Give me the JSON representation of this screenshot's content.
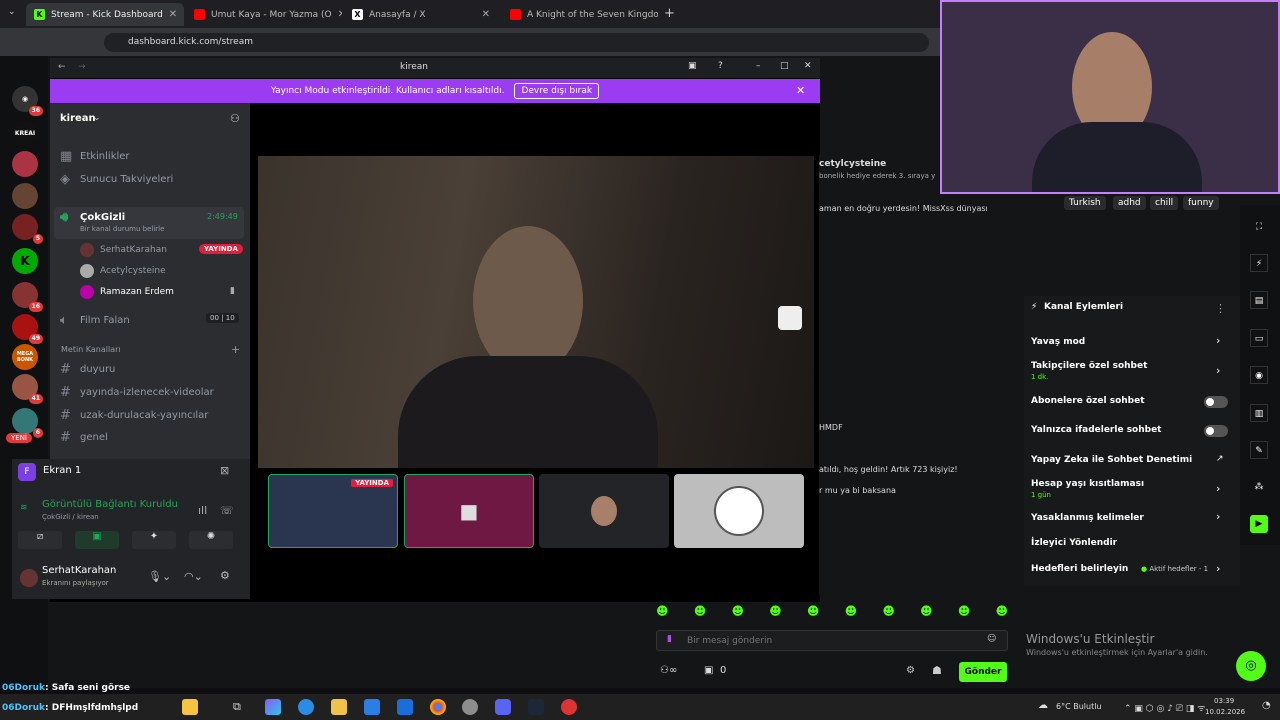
{
  "browser": {
    "tabs": [
      {
        "label": "Stream - Kick Dashboard",
        "active": true
      },
      {
        "label": "Umut Kaya - Mor Yazma (O",
        "active": false
      },
      {
        "label": "Anasayfa / X",
        "active": false
      },
      {
        "label": "A Knight of the Seven Kingdom",
        "active": false
      }
    ],
    "url": "dashboard.kick.com/stream"
  },
  "kick_sidebar": {
    "badges": [
      "36",
      "5",
      "6",
      "16",
      "49",
      "41",
      "6"
    ],
    "logo_label": "KREAI",
    "megabonk": "MEGA BONK",
    "new_label": "YENİ"
  },
  "discord": {
    "title": "kirean",
    "banner_text": "Yayıncı Modu etkinleştirildi. Kullanıcı adları kısaltıldı.",
    "banner_button": "Devre dışı bırak",
    "server_name": "kirean",
    "channels": {
      "events": "Etkinlikler",
      "boosts": "Sunucu Takviyeleri",
      "voice1": "ÇokGizli",
      "voice1_status": "Bir kanal durumu belirle",
      "voice1_time": "2:49:49",
      "voice_users": [
        "SerhatKarahan",
        "Acetylcysteine",
        "Ramazan Erdem"
      ],
      "live_label": "YAYINDA",
      "voice2": "Film Falan",
      "voice2_counts": [
        "00",
        "10"
      ],
      "category": "Metin Kanalları",
      "text_channels": [
        "duyuru",
        "yayında-izlenecek-videolar",
        "uzak-durulacak-yayıncılar",
        "genel"
      ]
    },
    "screen_share": "Ekran 1",
    "connection": "Görüntülü Bağlantı Kuruldu",
    "connection_sub": "ÇokGizli / kirean",
    "user": {
      "name": "SerhatKarahan",
      "status": "Ekranını paylaşıyor"
    },
    "thumb_live": "YAYINDA"
  },
  "chat": {
    "messages": [
      {
        "text": "cetylcysteine"
      },
      {
        "text": "bonelik hediye ederek 3. sıraya y"
      },
      {
        "text": "aman en doğru yerdesin! MissXss dünyası"
      },
      {
        "text": "HMDF"
      },
      {
        "text": "atıldı, hoş geldin! Artık 723 kişiyiz!"
      },
      {
        "text": "r mu ya bi baksana"
      }
    ],
    "tags": [
      "Turkish",
      "adhd",
      "chill",
      "funny"
    ],
    "placeholder": "Bir mesaj gönderin",
    "send": "Gönder",
    "count": "0"
  },
  "actions": {
    "title": "Kanal Eylemleri",
    "items": [
      {
        "label": "Yavaş mod",
        "sub": ""
      },
      {
        "label": "Takipçilere özel sohbet",
        "sub": "1 dk."
      },
      {
        "label": "Abonelere özel sohbet",
        "sub": ""
      },
      {
        "label": "Yalnızca ifadelerle sohbet",
        "sub": ""
      },
      {
        "label": "Yapay Zeka ile Sohbet Denetimi",
        "sub": ""
      },
      {
        "label": "Hesap yaşı kısıtlaması",
        "sub": "1 gün"
      },
      {
        "label": "Yasaklanmış kelimeler",
        "sub": ""
      },
      {
        "label": "İzleyici Yönlendir",
        "sub": ""
      },
      {
        "label": "Hedefleri belirleyin",
        "sub": "Aktif hedefler - 1"
      }
    ]
  },
  "windows": {
    "activate": "Windows'u Etkinleştir",
    "activate_sub": "Windows'u etkinleştirmek için Ayarlar'a gidin.",
    "weather": "6°C Bulutlu",
    "time": "03:39",
    "date": "10.02.2026"
  },
  "overlay": {
    "line1_user": "06Doruk",
    "line1_msg": ": Safa seni görse",
    "line2_user": "06Doruk",
    "line2_msg": ": DFHmşlfdmhşlpd"
  },
  "colors": {
    "kick_green": "#53fc18",
    "discord_purple": "#9b3cf3",
    "live_red": "#e11f3c"
  }
}
